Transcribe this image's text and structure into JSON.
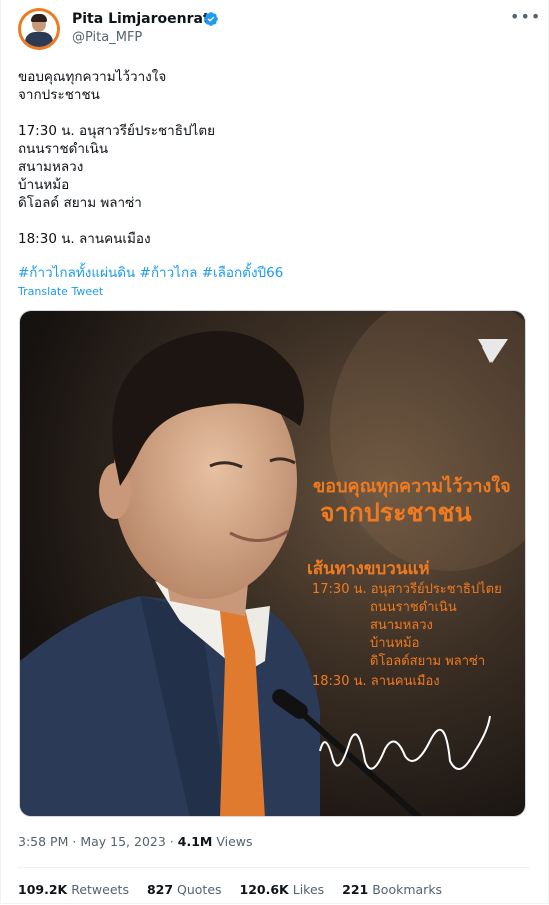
{
  "author": {
    "name": "Pita Limjaroenrat",
    "handle": "@Pita_MFP",
    "verified": true,
    "more_icon": "more-horizontal-icon"
  },
  "tweet": {
    "lines": [
      "ขอบคุณทุกความไว้วางใจ",
      "จากประชาชน",
      "",
      "17:30 น. อนุสาวรีย์ประชาธิปไตย",
      "ถนนราชดำเนิน",
      "สนามหลวง",
      "บ้านหม้อ",
      "ดิโอลด์ สยาม พลาซ่า",
      "",
      "18:30 น. ลานคนเมือง"
    ],
    "hashtags": [
      "#ก้าวไกลทั้งแผ่นดิน",
      "#ก้าวไกล",
      "#เลือกตั้งปี66"
    ],
    "translate_label": "Translate Tweet"
  },
  "media": {
    "headline_line1": "ขอบคุณทุกความไว้วางใจ",
    "headline_line2": "จากประชาชน",
    "route_title": "เส้นทางขบวนแห่",
    "route_lines": [
      "17:30 น. อนุสาวรีย์ประชาธิปไตย",
      "ถนนราชดำเนิน",
      "สนามหลวง",
      "บ้านหม้อ",
      "ดิโอลด์สยาม พลาซ่า",
      "18:30 น. ลานคนเมือง"
    ],
    "accent_color": "#f07a20",
    "logo_icon": "move-forward-party-logo-icon"
  },
  "meta": {
    "time": "3:58 PM",
    "separator": "·",
    "date": "May 15, 2023",
    "views_count": "4.1M",
    "views_label": "Views"
  },
  "stats": [
    {
      "count": "109.2K",
      "label": "Retweets"
    },
    {
      "count": "827",
      "label": "Quotes"
    },
    {
      "count": "120.6K",
      "label": "Likes"
    },
    {
      "count": "221",
      "label": "Bookmarks"
    }
  ],
  "colors": {
    "link": "#1d9bf0",
    "text": "#0f1419",
    "muted": "#536471"
  }
}
